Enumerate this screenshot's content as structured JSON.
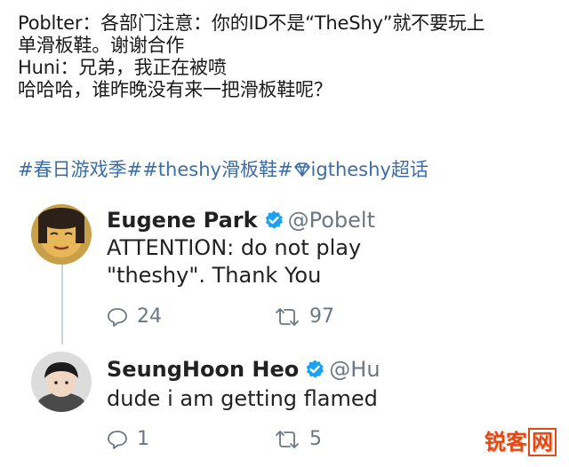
{
  "post": {
    "lines": [
      "Poblter：各部门注意：你的ID不是“TheShy”就不要玩上",
      "单滑板鞋。谢谢合作",
      "Huni：兄弟，我正在被喷",
      "哈哈哈，谁昨晚没有来一把滑板鞋呢？"
    ],
    "hashtags": [
      "#春日游戏季#",
      "#theshy滑板鞋#",
      "igtheshy超话"
    ]
  },
  "tweets": [
    {
      "display_name": "Eugene Park",
      "handle": "@Pobelt",
      "text_lines": [
        "ATTENTION: do not play",
        "\"theshy\". Thank You"
      ],
      "reply_count": "24",
      "retweet_count": "97"
    },
    {
      "display_name": "SeungHoon Heo",
      "handle": "@Hu",
      "text_lines": [
        "dude i am getting flamed"
      ],
      "reply_count": "1",
      "retweet_count": "5"
    }
  ],
  "watermark": {
    "part1": "锐客",
    "part2": "网"
  },
  "colors": {
    "hashtag": "#3b6ea8",
    "verified": "#1da1f2",
    "muted": "#6b7783",
    "watermark": "#e04a16"
  }
}
